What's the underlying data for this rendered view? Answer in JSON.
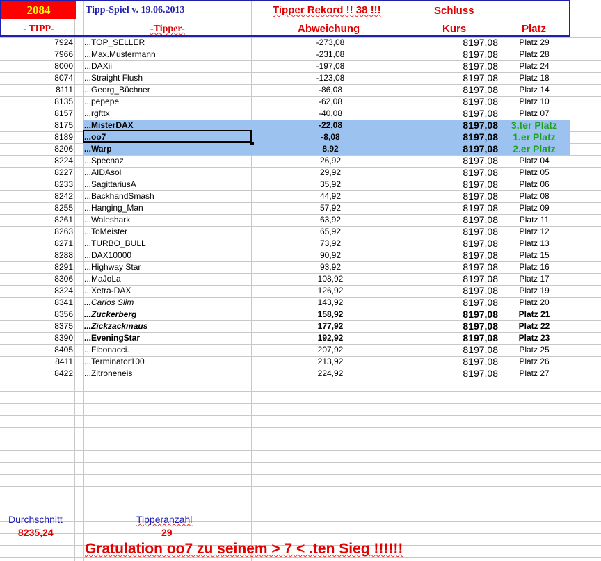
{
  "header": {
    "number": "2084",
    "title": "Tipp-Spiel v. 19.06.2013",
    "rekord": "Tipper Rekord !!  38  !!!",
    "schluss": "Schluss",
    "col_tipp": "- TIPP-",
    "col_tipper": "-Tipper-",
    "col_abweichung": "Abweichung",
    "col_kurs": "Kurs",
    "col_platz": "Platz"
  },
  "rows": [
    {
      "tipp": "7924",
      "name": "...TOP_SELLER",
      "abw": "-273,08",
      "kurs": "8197,08",
      "platz": "Platz 29"
    },
    {
      "tipp": "7966",
      "name": "...Max.Mustermann",
      "abw": "-231,08",
      "kurs": "8197,08",
      "platz": "Platz 28"
    },
    {
      "tipp": "8000",
      "name": "...DAXii",
      "abw": "-197,08",
      "kurs": "8197,08",
      "platz": "Platz 24"
    },
    {
      "tipp": "8074",
      "name": "...Straight Flush",
      "abw": "-123,08",
      "kurs": "8197,08",
      "platz": "Platz 18"
    },
    {
      "tipp": "8111",
      "name": "...Georg_Büchner",
      "abw": "-86,08",
      "kurs": "8197,08",
      "platz": "Platz 14"
    },
    {
      "tipp": "8135",
      "name": "...pepepe",
      "abw": "-62,08",
      "kurs": "8197,08",
      "platz": "Platz 10"
    },
    {
      "tipp": "8157",
      "name": "...rgfttx",
      "abw": "-40,08",
      "kurs": "8197,08",
      "platz": "Platz 07"
    },
    {
      "tipp": "8175",
      "name": "...MisterDAX",
      "abw": "-22,08",
      "kurs": "8197,08",
      "platz": "3.ter Platz"
    },
    {
      "tipp": "8189",
      "name": "...oo7",
      "abw": "-8,08",
      "kurs": "8197,08",
      "platz": "1.er Platz"
    },
    {
      "tipp": "8206",
      "name": "...Warp",
      "abw": "8,92",
      "kurs": "8197,08",
      "platz": "2.er Platz"
    },
    {
      "tipp": "8224",
      "name": "...Specnaz.",
      "abw": "26,92",
      "kurs": "8197,08",
      "platz": "Platz 04"
    },
    {
      "tipp": "8227",
      "name": "...AIDAsol",
      "abw": "29,92",
      "kurs": "8197,08",
      "platz": "Platz 05"
    },
    {
      "tipp": "8233",
      "name": "...SagittariusA",
      "abw": "35,92",
      "kurs": "8197,08",
      "platz": "Platz 06"
    },
    {
      "tipp": "8242",
      "name": "...BackhandSmash",
      "abw": "44,92",
      "kurs": "8197,08",
      "platz": "Platz 08"
    },
    {
      "tipp": "8255",
      "name": "...Hanging_Man",
      "abw": "57,92",
      "kurs": "8197,08",
      "platz": "Platz 09"
    },
    {
      "tipp": "8261",
      "name": "...Waleshark",
      "abw": "63,92",
      "kurs": "8197,08",
      "platz": "Platz 11"
    },
    {
      "tipp": "8263",
      "name": "...ToMeister",
      "abw": "65,92",
      "kurs": "8197,08",
      "platz": "Platz 12"
    },
    {
      "tipp": "8271",
      "name": "...TURBO_BULL",
      "abw": "73,92",
      "kurs": "8197,08",
      "platz": "Platz 13"
    },
    {
      "tipp": "8288",
      "name": "...DAX10000",
      "abw": "90,92",
      "kurs": "8197,08",
      "platz": "Platz 15"
    },
    {
      "tipp": "8291",
      "name": "...Highway Star",
      "abw": "93,92",
      "kurs": "8197,08",
      "platz": "Platz 16"
    },
    {
      "tipp": "8306",
      "name": "...MaJoLa",
      "abw": "108,92",
      "kurs": "8197,08",
      "platz": "Platz 17"
    },
    {
      "tipp": "8324",
      "name": "...Xetra-DAX",
      "abw": "126,92",
      "kurs": "8197,08",
      "platz": "Platz 19"
    },
    {
      "tipp": "8341",
      "name": "...Carlos Slim",
      "abw": "143,92",
      "kurs": "8197,08",
      "platz": "Platz 20"
    },
    {
      "tipp": "8356",
      "name": "...Zuckerberg",
      "abw": "158,92",
      "kurs": "8197,08",
      "platz": "Platz 21"
    },
    {
      "tipp": "8375",
      "name": "...Zickzackmaus",
      "abw": "177,92",
      "kurs": "8197,08",
      "platz": "Platz 22"
    },
    {
      "tipp": "8390",
      "name": "...EveningStar",
      "abw": "192,92",
      "kurs": "8197,08",
      "platz": "Platz 23"
    },
    {
      "tipp": "8405",
      "name": "...Fibonacci.",
      "abw": "207,92",
      "kurs": "8197,08",
      "platz": "Platz 25"
    },
    {
      "tipp": "8411",
      "name": "...Terminator100",
      "abw": "213,92",
      "kurs": "8197,08",
      "platz": "Platz 26"
    },
    {
      "tipp": "8422",
      "name": "...Zitroneneis",
      "abw": "224,92",
      "kurs": "8197,08",
      "platz": "Platz 27"
    }
  ],
  "footer": {
    "durchschnitt_label": "Durchschnitt",
    "durchschnitt_value": "8235,24",
    "tipperanzahl_label": "Tipperanzahl",
    "tipperanzahl_value": "29",
    "gratulation": "Gratulation oo7 zu seinem > 7 < .ten Sieg !!!!!!"
  },
  "colors": {
    "header_border": "#1f1fb0",
    "highlight_rows": "#9cc3f0",
    "red": "#e00000",
    "green": "#1aa31a",
    "blue": "#1f1fb0"
  }
}
